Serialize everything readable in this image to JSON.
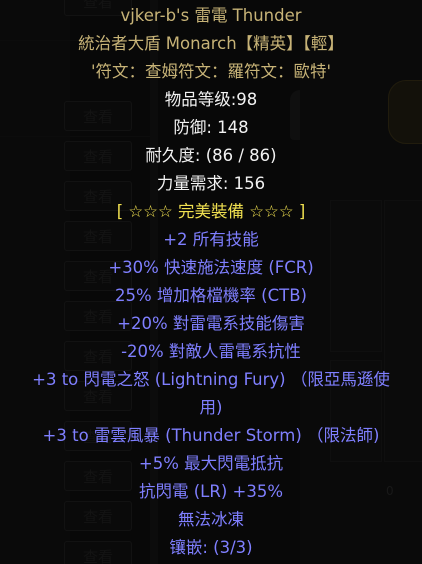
{
  "tooltip": {
    "name": "vjker-b's 雷電 Thunder",
    "base": "統治者大盾 Monarch【精英】【輕】",
    "runes": "'符文：查姆符文：羅符文：歐特'",
    "item_level": "物品等级:98",
    "defense": "防御: 148",
    "durability": "耐久度: (86 / 86)",
    "strength_req": "力量需求: 156",
    "quality": "[ ☆☆☆ 完美裝備 ☆☆☆ ]",
    "mods": [
      "+2 所有技能",
      "+30% 快速施法速度 (FCR)",
      "25% 增加格檔機率 (CTB)",
      "+20% 對雷電系技能傷害",
      "-20% 對敵人雷電系抗性",
      "+3 to 閃電之怒 (Lightning Fury) （限亞馬遜使",
      "用)",
      "+3 to 雷雲風暴 (Thunder Storm) （限法師)",
      "+5% 最大閃電抵抗",
      "抗閃電 (LR) +35%",
      "無法冰凍",
      "镶嵌: (3/3)"
    ]
  },
  "background": {
    "view_button_label": "查看",
    "slot_count": "0"
  },
  "colors": {
    "white": "#f2f2f2",
    "gold": "#c7b377",
    "magic_blue": "#7f7fff",
    "quality_yellow": "#f0e050"
  }
}
